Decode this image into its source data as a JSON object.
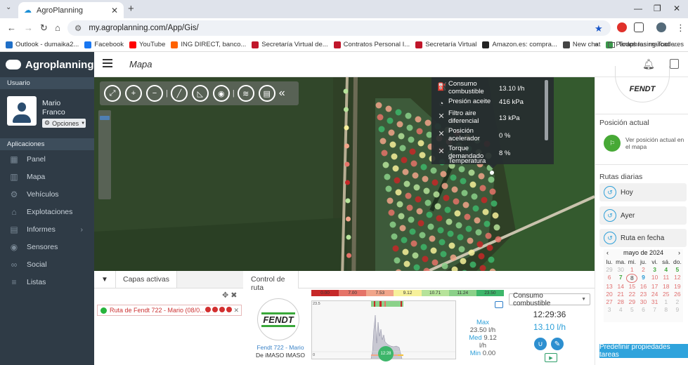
{
  "browser": {
    "tab_title": "AgroPlanning",
    "url": "my.agroplanning.com/App/Gis/",
    "bookmarks": [
      "Outlook - dumaika2...",
      "Facebook",
      "YouTube",
      "ING DIRECT, banco...",
      "Secretaría Virtual de...",
      "Contratos Personal I...",
      "Secretaría Virtual",
      "Amazon.es: compra...",
      "New chat",
      "Paraphrasing Tool -..."
    ],
    "bookmark_colors": [
      "#1f6fc7",
      "#1877f2",
      "#ff0000",
      "#ff6200",
      "#c0162a",
      "#c0162a",
      "#c0162a",
      "#222222",
      "#444444",
      "#3a9b4b"
    ],
    "bookmarks_more": "»",
    "all_bookmarks": "Todos los marcadores"
  },
  "header": {
    "brand": "Agroplanning",
    "page_title": "Mapa"
  },
  "sidebar": {
    "user_section": "Usuario",
    "user_name": "Mario Franco Ramos",
    "options_label": "Opciones",
    "apps_section": "Aplicaciones",
    "items": [
      {
        "label": "Panel",
        "icon": "grid-icon"
      },
      {
        "label": "Mapa",
        "icon": "map-icon"
      },
      {
        "label": "Vehículos",
        "icon": "tractor-icon"
      },
      {
        "label": "Explotaciones",
        "icon": "farm-icon"
      },
      {
        "label": "Informes",
        "icon": "report-icon"
      },
      {
        "label": "Sensores",
        "icon": "sensor-icon"
      },
      {
        "label": "Social",
        "icon": "share-icon"
      },
      {
        "label": "Listas",
        "icon": "list-icon"
      }
    ]
  },
  "popup": {
    "rows": [
      {
        "label": "Consumo combustible",
        "value": "13.10 l/h"
      },
      {
        "label": "Presión aceite",
        "value": "416 kPa"
      },
      {
        "label": "Filtro aire diferencial",
        "value": "13 kPa"
      },
      {
        "label": "Posición acelerador",
        "value": "0 %"
      },
      {
        "label": "Torque demandado",
        "value": "8 %"
      }
    ],
    "cutoff_label": "Temperatura"
  },
  "layers": {
    "tab_label": "Capas activas",
    "row_label": "Ruta de Fendt 722 - Mario (08/0..."
  },
  "route": {
    "tab_label": "Control de ruta",
    "brand_logo": "FENDT",
    "vehicle_name": "Fendt 722 - Mario",
    "vehicle_owner": "De iMASO IMASO",
    "scale": [
      "0.00",
      "7.00",
      "7.53",
      "9.12",
      "10.71",
      "11.24",
      "23.50"
    ],
    "scale_colors": [
      "#c62828",
      "#e57368",
      "#f1a58a",
      "#f7f19a",
      "#b6e39a",
      "#8bd189",
      "#3db66a"
    ],
    "chart_ymax": "23.5",
    "chart_ymin": "0",
    "cursor_time": "12:28",
    "stats": {
      "max_label": "Max",
      "max_value": "23.50 l/h",
      "med_label": "Med",
      "med_value": "9.12",
      "med_unit": "l/h",
      "min_label": "Min",
      "min_value": "0.00"
    },
    "variable": "Consumo combustible",
    "time": "12:29:36",
    "current_value": "13.10 l/h"
  },
  "right": {
    "brand_logo": "FENDT",
    "pos_title": "Posición actual",
    "pos_text": "Ver posición actual en el mapa",
    "routes_title": "Rutas diarias",
    "btn_today": "Hoy",
    "btn_yesterday": "Ayer",
    "btn_date": "Ruta en fecha",
    "calendar": {
      "month": "mayo de 2024",
      "dow": [
        "lu.",
        "ma.",
        "mi.",
        "ju.",
        "vi.",
        "sá.",
        "do."
      ],
      "weeks": [
        [
          "29",
          "30",
          "1",
          "2",
          "3",
          "4",
          "5"
        ],
        [
          "6",
          "7",
          "8",
          "9",
          "10",
          "11",
          "12"
        ],
        [
          "13",
          "14",
          "15",
          "16",
          "17",
          "18",
          "19"
        ],
        [
          "20",
          "21",
          "22",
          "23",
          "24",
          "25",
          "26"
        ],
        [
          "27",
          "28",
          "29",
          "30",
          "31",
          "1",
          "2"
        ],
        [
          "3",
          "4",
          "5",
          "6",
          "7",
          "8",
          "9"
        ]
      ]
    },
    "predef": "Predefinir propiedades tareas"
  }
}
